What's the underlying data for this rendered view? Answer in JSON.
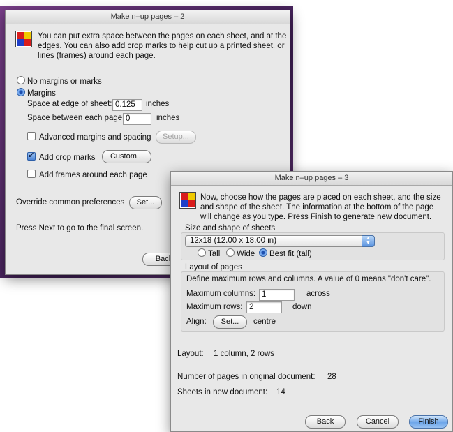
{
  "window1": {
    "title": "Make n–up pages – 2",
    "intro_line1": "You can put extra space between the pages on each sheet, and at the",
    "intro_line2": "edges. You can also add crop marks to help cut up a printed sheet, or",
    "intro_line3": "lines (frames) around each page.",
    "no_margins_label": "No margins or marks",
    "margins_label": "Margins",
    "edge_label": "Space at edge of sheet:",
    "edge_value": "0.125",
    "edge_unit": "inches",
    "between_label": "Space between each page:",
    "between_value": "0",
    "between_unit": "inches",
    "advanced_label": "Advanced margins and spacing",
    "setup_button": "Setup...",
    "crop_label": "Add crop marks",
    "custom_button": "Custom...",
    "frames_label": "Add frames around each page",
    "override_label": "Override common preferences",
    "set_button": "Set...",
    "next_hint": "Press Next to go to the final screen.",
    "back_button": "Back"
  },
  "window2": {
    "title": "Make n–up pages – 3",
    "intro_line1": "Now, choose how the pages are placed on each sheet, and the size",
    "intro_line2": "and shape of the sheet. The information at the bottom of the page",
    "intro_line3": "will change as you type. Press Finish to generate new document.",
    "size_group_title": "Size and shape of sheets",
    "sheet_size_value": "12x18 (12.00 x 18.00 in)",
    "orient_tall": "Tall",
    "orient_wide": "Wide",
    "orient_best": "Best fit (tall)",
    "layout_group_title": "Layout of pages",
    "layout_desc": "Define maximum rows and columns. A value of 0 means \"don't care\".",
    "max_cols_label": "Maximum columns:",
    "max_cols_value": "1",
    "across_label": "across",
    "max_rows_label": "Maximum rows:",
    "max_rows_value": "2",
    "down_label": "down",
    "align_label": "Align:",
    "align_button": "Set...",
    "align_value": "centre",
    "layout_summary_label": "Layout:",
    "layout_summary_value": "1 column, 2 rows",
    "pages_original_label": "Number of pages in original document:",
    "pages_original_value": "28",
    "sheets_new_label": "Sheets in new document:",
    "sheets_new_value": "14",
    "back_button": "Back",
    "cancel_button": "Cancel",
    "finish_button": "Finish"
  },
  "colors": {
    "desktop_background": "#5b2f6e",
    "window_background": "#e8e8e8",
    "default_button": "#6ea6ea"
  }
}
